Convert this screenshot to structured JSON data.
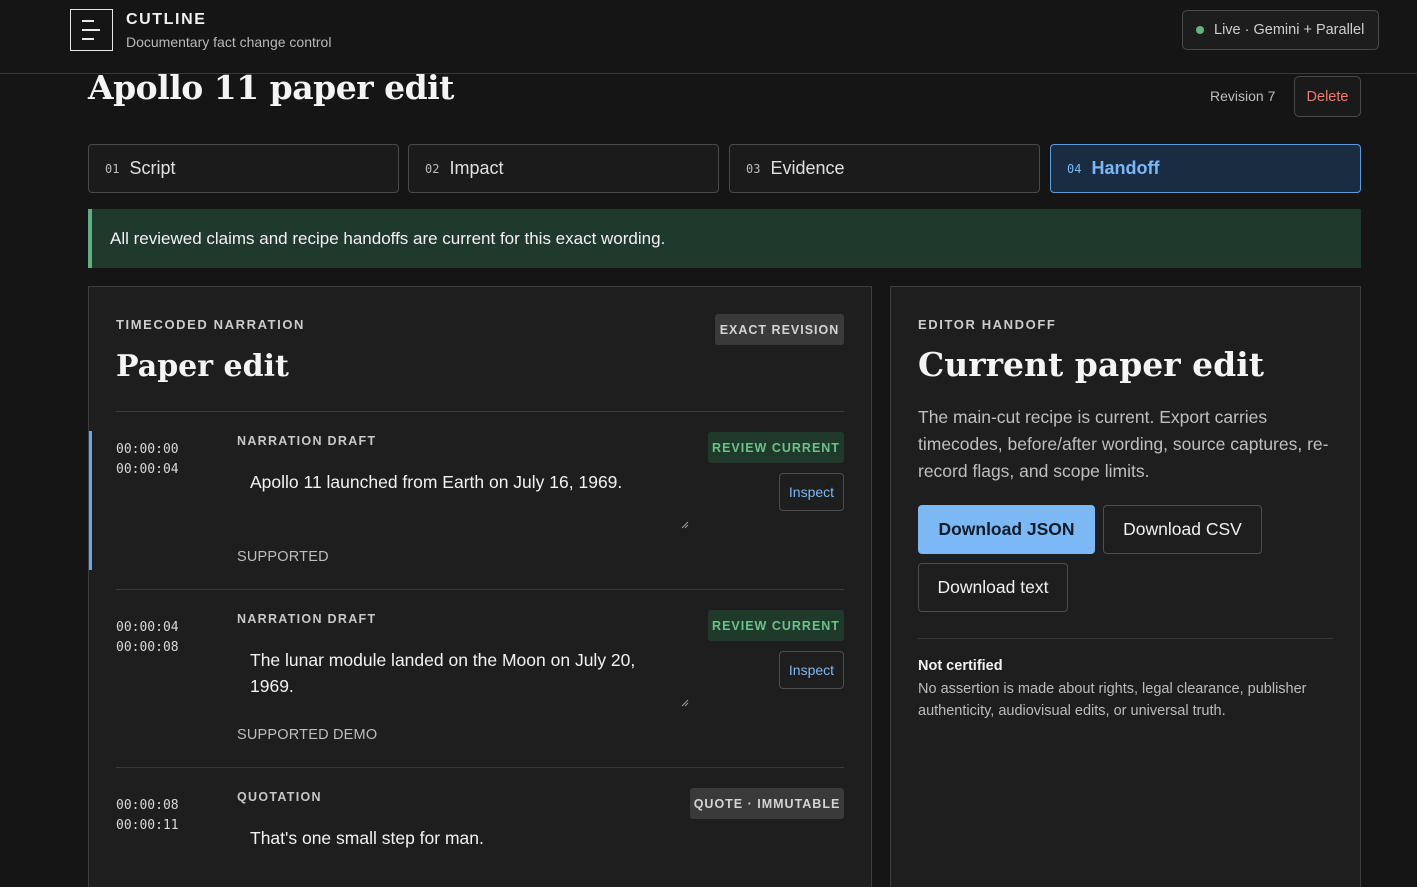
{
  "app": {
    "name": "CUTLINE",
    "subtitle": "Documentary fact change control",
    "status_label": "Live · Gemini + Parallel",
    "status_color": "#5fb77d"
  },
  "page": {
    "title": "Apollo 11 paper edit",
    "revision": "Revision 7",
    "delete_label": "Delete"
  },
  "tabs": [
    {
      "num": "01",
      "label": "Script",
      "active": false
    },
    {
      "num": "02",
      "label": "Impact",
      "active": false
    },
    {
      "num": "03",
      "label": "Evidence",
      "active": false
    },
    {
      "num": "04",
      "label": "Handoff",
      "active": true
    }
  ],
  "banner": {
    "text": "All reviewed claims and recipe handoffs are current for this exact wording."
  },
  "narration": {
    "kicker": "TIMECODED NARRATION",
    "title": "Paper edit",
    "tag": "EXACT REVISION",
    "rows": [
      {
        "tc_in": "00:00:00",
        "tc_out": "00:00:04",
        "kind": "NARRATION DRAFT",
        "text": "Apollo 11 launched from Earth on July 16, 1969.",
        "badge": "REVIEW CURRENT",
        "action": "Inspect",
        "status": "SUPPORTED"
      },
      {
        "tc_in": "00:00:04",
        "tc_out": "00:00:08",
        "kind": "NARRATION DRAFT",
        "text": "The lunar module landed on the Moon on July 20, 1969.",
        "badge": "REVIEW CURRENT",
        "action": "Inspect",
        "status": "SUPPORTED DEMO"
      },
      {
        "tc_in": "00:00:08",
        "tc_out": "00:00:11",
        "kind": "QUOTATION",
        "text": "That's one small step for man.",
        "badge": "QUOTE · IMMUTABLE"
      }
    ]
  },
  "handoff": {
    "kicker": "EDITOR HANDOFF",
    "title": "Current paper edit",
    "description": "The main-cut recipe is current. Export carries timecodes, before/after wording, source captures, re-record flags, and scope limits.",
    "buttons": {
      "json": "Download JSON",
      "csv": "Download CSV",
      "text": "Download text"
    },
    "not_certified_title": "Not certified",
    "not_certified_text": "No assertion is made about rights, legal clearance, publisher authenticity, audiovisual edits, or universal truth."
  }
}
